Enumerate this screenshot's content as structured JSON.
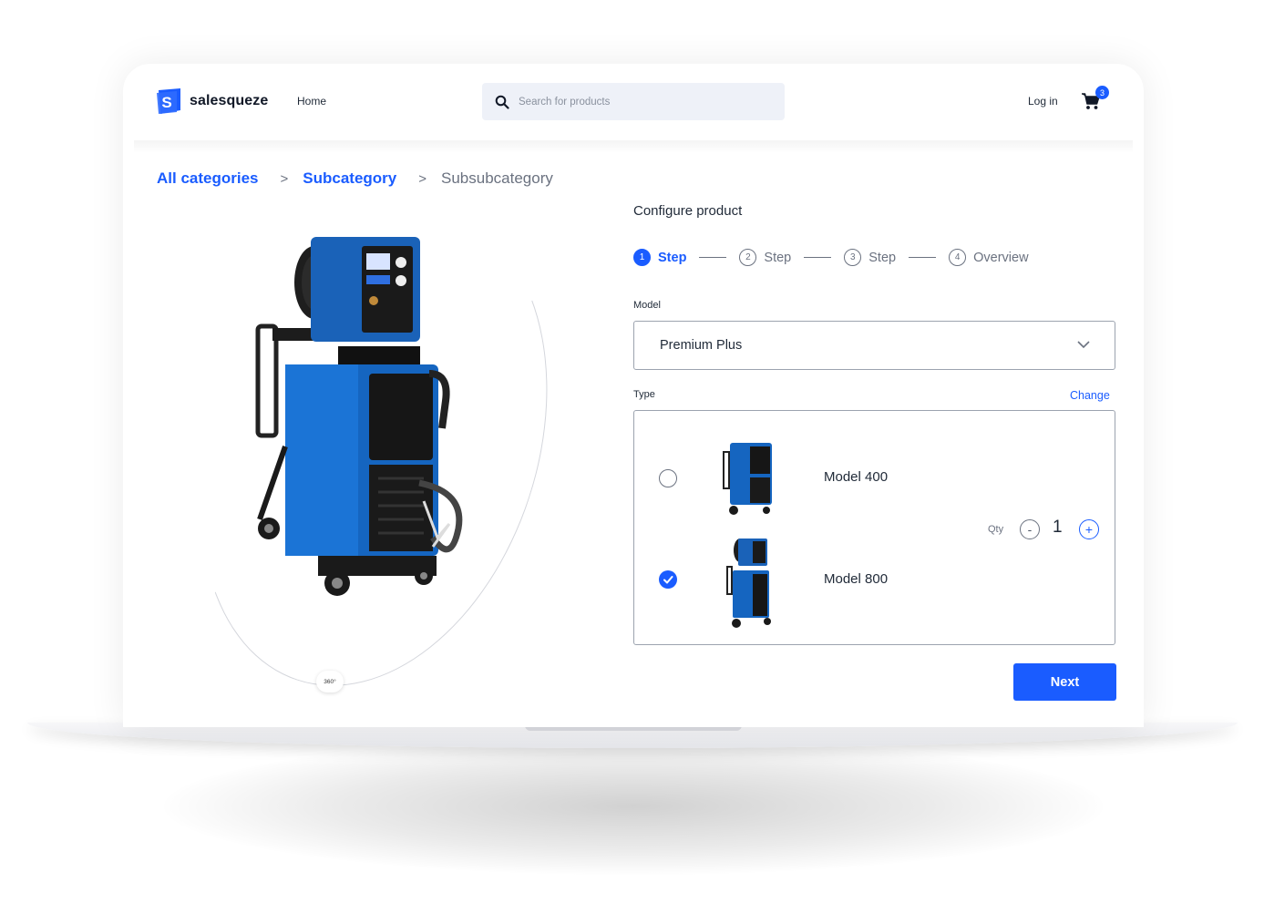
{
  "brand": {
    "name": "salesqueze",
    "accent": "#1a5cff"
  },
  "nav": {
    "home": "Home",
    "login": "Log in",
    "cart_count": "3"
  },
  "search": {
    "placeholder": "Search for products"
  },
  "breadcrumb": {
    "level1": "All categories",
    "level2": "Subcategory",
    "level3": "Subsubcategory",
    "separator": ">"
  },
  "product": {
    "badge_360": "360°"
  },
  "config": {
    "title": "Configure product",
    "steps": [
      {
        "num": "1",
        "label": "Step",
        "active": true
      },
      {
        "num": "2",
        "label": "Step",
        "active": false
      },
      {
        "num": "3",
        "label": "Step",
        "active": false
      },
      {
        "num": "4",
        "label": "Overview",
        "active": false
      }
    ],
    "model_label": "Model",
    "model_value": "Premium Plus",
    "type_label": "Type",
    "change_label": "Change",
    "options": [
      {
        "name": "Model 400",
        "selected": false
      },
      {
        "name": "Model 800",
        "selected": true
      }
    ],
    "qty_label": "Qty",
    "qty_minus": "-",
    "qty_value": "1",
    "qty_plus": "+",
    "next_label": "Next"
  },
  "icons": {
    "search": "search-icon",
    "cart": "cart-icon",
    "chevron": "chevron-down-icon",
    "check": "check-icon"
  }
}
